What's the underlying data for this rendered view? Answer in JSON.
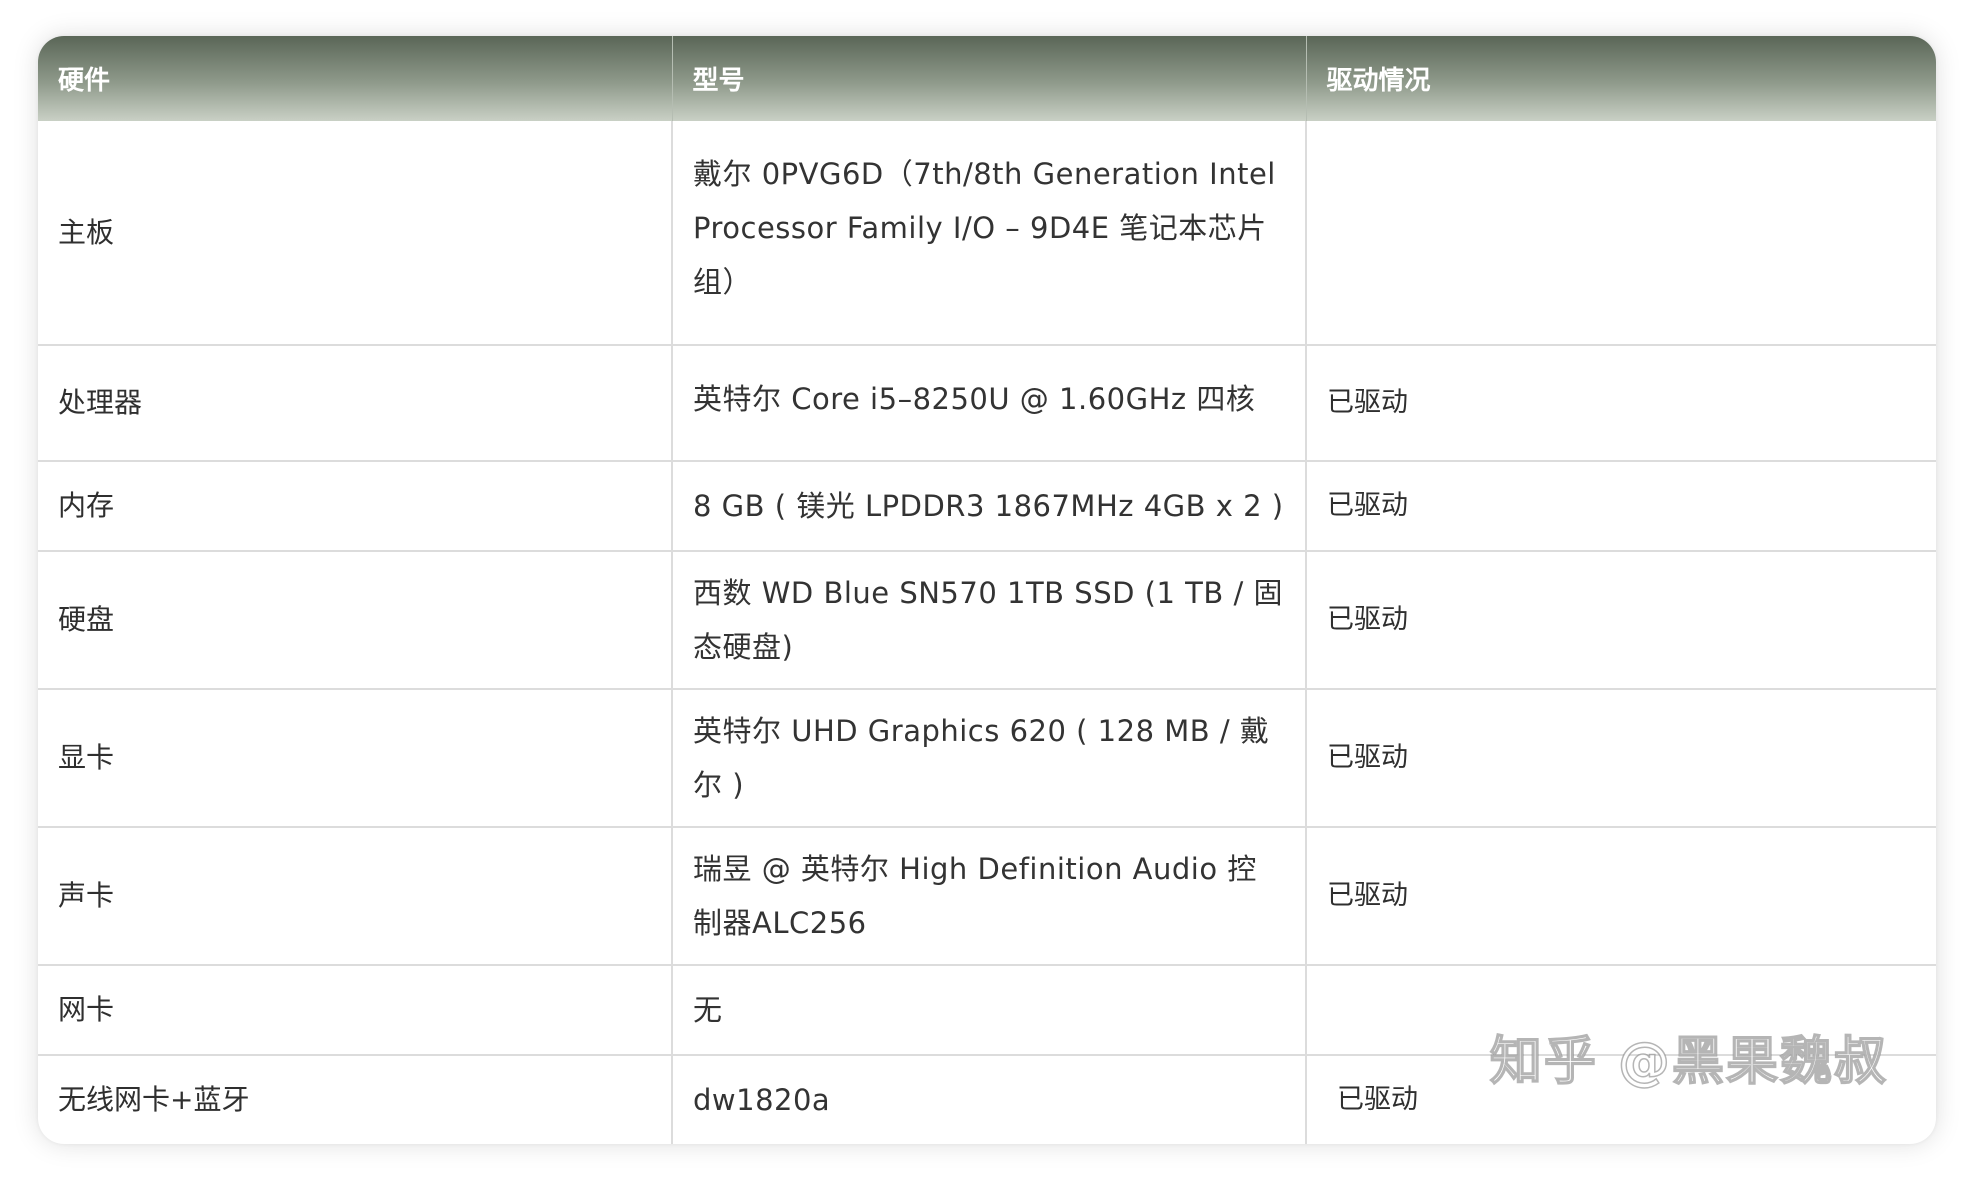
{
  "headers": {
    "hardware": "硬件",
    "model": "型号",
    "driver": "驱动情况"
  },
  "rows": [
    {
      "hardware": "主板",
      "model": "戴尔 0PVG6D（7th/8th Generation Intel Processor Family I/O – 9D4E 笔记本芯片组）",
      "driver": ""
    },
    {
      "hardware": "处理器",
      "model": "英特尔 Core i5–8250U @ 1.60GHz 四核",
      "driver": "已驱动"
    },
    {
      "hardware": "内存",
      "model": "8 GB ( 镁光 LPDDR3 1867MHz 4GB x 2 )",
      "driver": "已驱动"
    },
    {
      "hardware": "硬盘",
      "model": "西数 WD Blue SN570 1TB SSD (1 TB / 固态硬盘)",
      "driver": "已驱动"
    },
    {
      "hardware": "显卡",
      "model": "英特尔 UHD Graphics 620 ( 128 MB / 戴尔 )",
      "driver": "已驱动"
    },
    {
      "hardware": "声卡",
      "model": "瑞昱 @ 英特尔 High Definition Audio 控制器ALC256",
      "driver": "已驱动"
    },
    {
      "hardware": "网卡",
      "model": "无",
      "driver": ""
    },
    {
      "hardware": "无线网卡+蓝牙",
      "model": "dw1820a",
      "driver": "已驱动"
    }
  ],
  "watermark": "知乎 @黑果魏叔"
}
